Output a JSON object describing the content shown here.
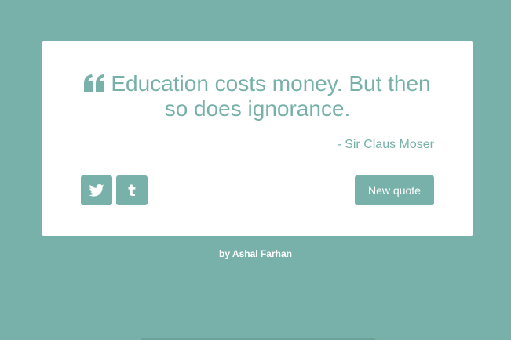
{
  "colors": {
    "background": "#77b1a9",
    "card": "#ffffff",
    "accent": "#77b1a9"
  },
  "quote": {
    "icon": "quote-left-icon",
    "text": "Education costs money. But then so does ignorance.",
    "author": "- Sir Claus Moser"
  },
  "actions": {
    "twitter_icon": "twitter-icon",
    "tumblr_icon": "tumblr-icon",
    "tumblr_glyph": "t",
    "new_quote_label": "New quote"
  },
  "footer": {
    "credit": "by Ashal Farhan"
  }
}
